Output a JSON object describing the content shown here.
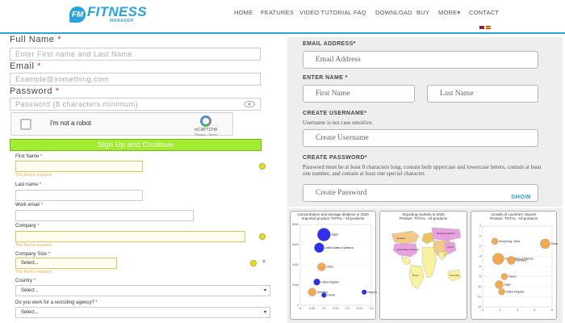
{
  "header": {
    "logo_badge": "FM",
    "logo_main": "FITNESS",
    "logo_sub": "MANAGER",
    "nav": [
      "HOME",
      "FEATURES",
      "VIDEO TUTORIAL",
      "FAQ",
      "DOWNLOAD",
      "BUY",
      "MORE",
      "CONTACT"
    ],
    "more_caret": "▾"
  },
  "left_form": {
    "full_name_label": "Full Name",
    "full_name_placeholder": "Enter First name and Last Name",
    "email_label": "Email",
    "email_placeholder": "Example@something.com",
    "password_label": "Password",
    "password_placeholder": "Password (8 characters minimum)",
    "required_mark": "*",
    "captcha_text": "I'm not a robot",
    "captcha_brand": "reCAPTCHA",
    "captcha_links": "Privacy - Terms",
    "signup_button": "Sign Up and Continue"
  },
  "small_form": {
    "first_name_label": "First Name",
    "last_name_label": "Last name",
    "work_email_label": "Work email",
    "company_label": "Company",
    "company_size_label": "Company Size",
    "country_label": "Country",
    "recruiting_label": "Do you work for a recruiting agency?",
    "required_error": "This field is required.",
    "select_placeholder": "Select...",
    "eq": "="
  },
  "right_form": {
    "email_label": "EMAIL ADDRESS*",
    "email_placeholder": "Email Address",
    "name_label": "ENTER NAME *",
    "first_placeholder": "First Name",
    "last_placeholder": "Last Name",
    "username_label": "CREATE USERNAME*",
    "username_help": "Username is not case sensitive.",
    "username_placeholder": "Create Username",
    "password_label": "CREATE PASSWORD*",
    "password_help": "Password must be at least 8 characters long, contain both uppercase and lowercase letters, contain at least one number, and contain at least one special character.",
    "password_placeholder": "Create Password",
    "show_label": "SHOW"
  },
  "chart_data": [
    {
      "type": "scatter",
      "title": "Concentration and average distance in 2020",
      "subtitle": "Imported product: TOTAL - All products",
      "ylim": [
        0,
        8000
      ],
      "yticks": [
        "8000",
        "6000",
        "4000",
        "2000",
        "0"
      ],
      "xticks": [
        "0",
        "0.05",
        "0.1",
        "0.15",
        "0.2",
        "0.25",
        "0.3"
      ],
      "xlim": [
        0,
        0.3
      ],
      "points": [
        {
          "name": "Japan",
          "x": 0.1,
          "y": 7000,
          "r": 8,
          "color": "#1a1ae6"
        },
        {
          "name": "United States of America",
          "x": 0.08,
          "y": 5700,
          "r": 6,
          "color": "#1a1ae6"
        },
        {
          "name": "China",
          "x": 0.09,
          "y": 3800,
          "r": 5,
          "color": "#f0a040"
        },
        {
          "name": "United Kingdom",
          "x": 0.07,
          "y": 2300,
          "r": 4,
          "color": "#1a1ae6"
        },
        {
          "name": "Germany",
          "x": 0.05,
          "y": 1300,
          "r": 5,
          "color": "#f0a040"
        },
        {
          "name": "France",
          "x": 0.1,
          "y": 1000,
          "r": 3,
          "color": "#1a1ae6"
        },
        {
          "name": "Hong Kong, China",
          "x": 0.27,
          "y": 1300,
          "r": 3,
          "color": "#1a1ae6"
        }
      ]
    },
    {
      "type": "map",
      "title": "Importing markets in 2020",
      "subtitle": "Product: TOTAL - All products",
      "regions": [
        "Canada",
        "United States of America",
        "Russian Federation",
        "China",
        "Brazil",
        "Australia"
      ]
    },
    {
      "type": "scatter",
      "title": "Growth of countries' imports",
      "subtitle": "Product: TOTAL - All products",
      "ylim": [
        -14,
        2
      ],
      "yticks": [
        "2",
        "0",
        "-2",
        "-4",
        "-6",
        "-8",
        "-10",
        "-12",
        "-14"
      ],
      "xticks": [
        "0",
        "2",
        "4",
        "6",
        "8"
      ],
      "xlim": [
        0,
        8
      ],
      "points": [
        {
          "name": "Hong Kong, China",
          "x": 1.4,
          "y": -1,
          "r": 4,
          "color": "#f0a040"
        },
        {
          "name": "China",
          "x": 7.2,
          "y": -1.5,
          "r": 6,
          "color": "#f0a040"
        },
        {
          "name": "United States of America",
          "x": 1.8,
          "y": -4.5,
          "r": 7,
          "color": "#f0a040"
        },
        {
          "name": "Germany",
          "x": 3.3,
          "y": -4.8,
          "r": 5,
          "color": "#f0a040"
        },
        {
          "name": "France",
          "x": 2.5,
          "y": -8,
          "r": 4,
          "color": "#f0a040"
        },
        {
          "name": "Japan",
          "x": 1.9,
          "y": -9.6,
          "r": 5,
          "color": "#f0a040"
        },
        {
          "name": "United Kingdom",
          "x": 2.2,
          "y": -11,
          "r": 4,
          "color": "#f0a040"
        }
      ]
    }
  ]
}
